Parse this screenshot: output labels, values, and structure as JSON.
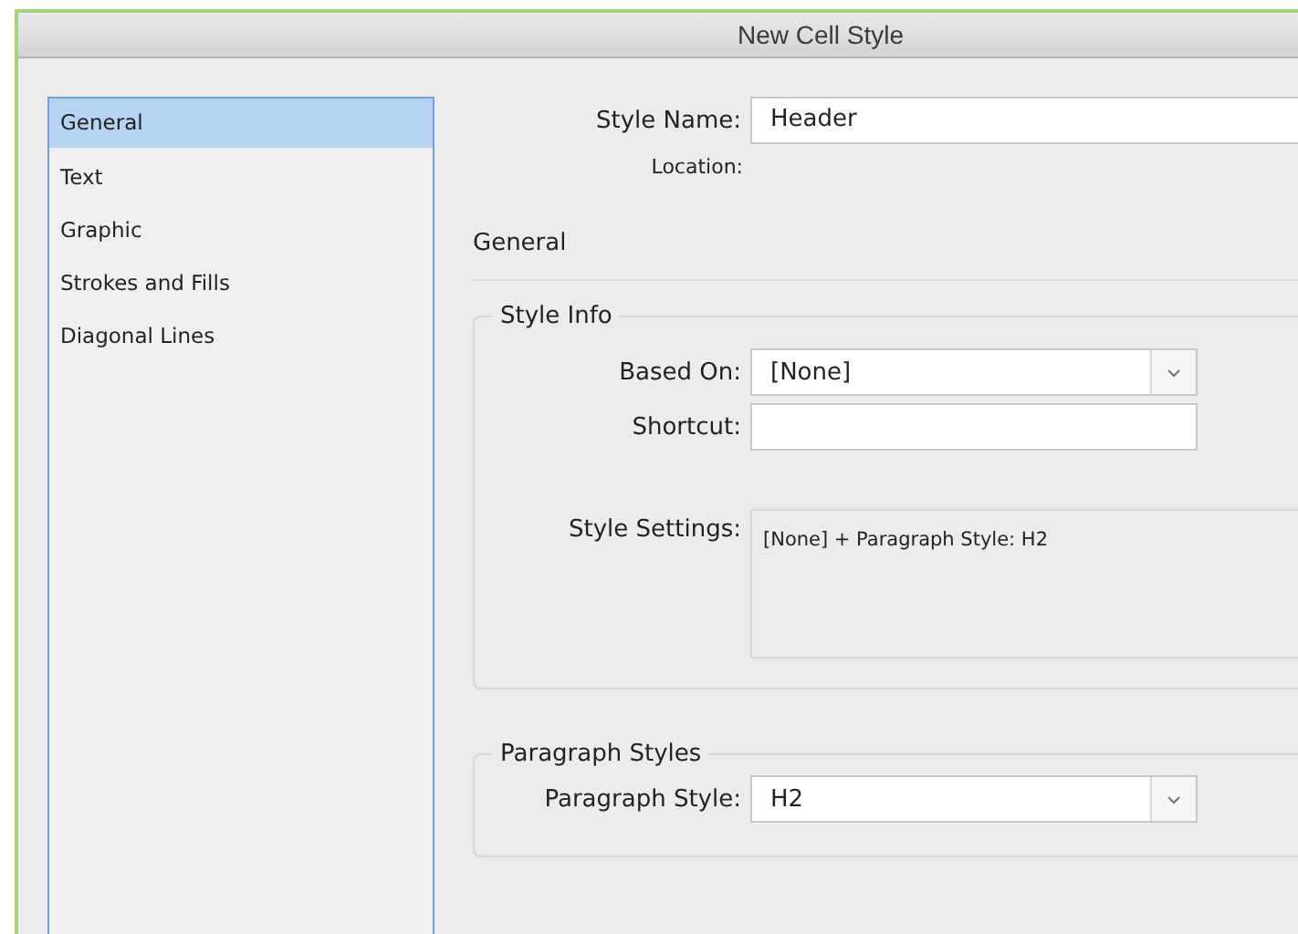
{
  "window": {
    "title": "New Cell Style"
  },
  "sidebar": {
    "items": [
      {
        "label": "General",
        "selected": true
      },
      {
        "label": "Text",
        "selected": false
      },
      {
        "label": "Graphic",
        "selected": false
      },
      {
        "label": "Strokes and Fills",
        "selected": false
      },
      {
        "label": "Diagonal Lines",
        "selected": false
      }
    ]
  },
  "style_name": {
    "label": "Style Name:",
    "value": "Header"
  },
  "location": {
    "label": "Location:"
  },
  "section_title": "General",
  "style_info": {
    "title": "Style Info",
    "based_on": {
      "label": "Based On:",
      "value": "[None]"
    },
    "shortcut": {
      "label": "Shortcut:"
    },
    "style_settings": {
      "label": "Style Settings:",
      "value": "[None] + Paragraph Style: H2"
    }
  },
  "paragraph_styles": {
    "title": "Paragraph Styles",
    "paragraph_style": {
      "label": "Paragraph Style:",
      "value": "H2"
    }
  }
}
